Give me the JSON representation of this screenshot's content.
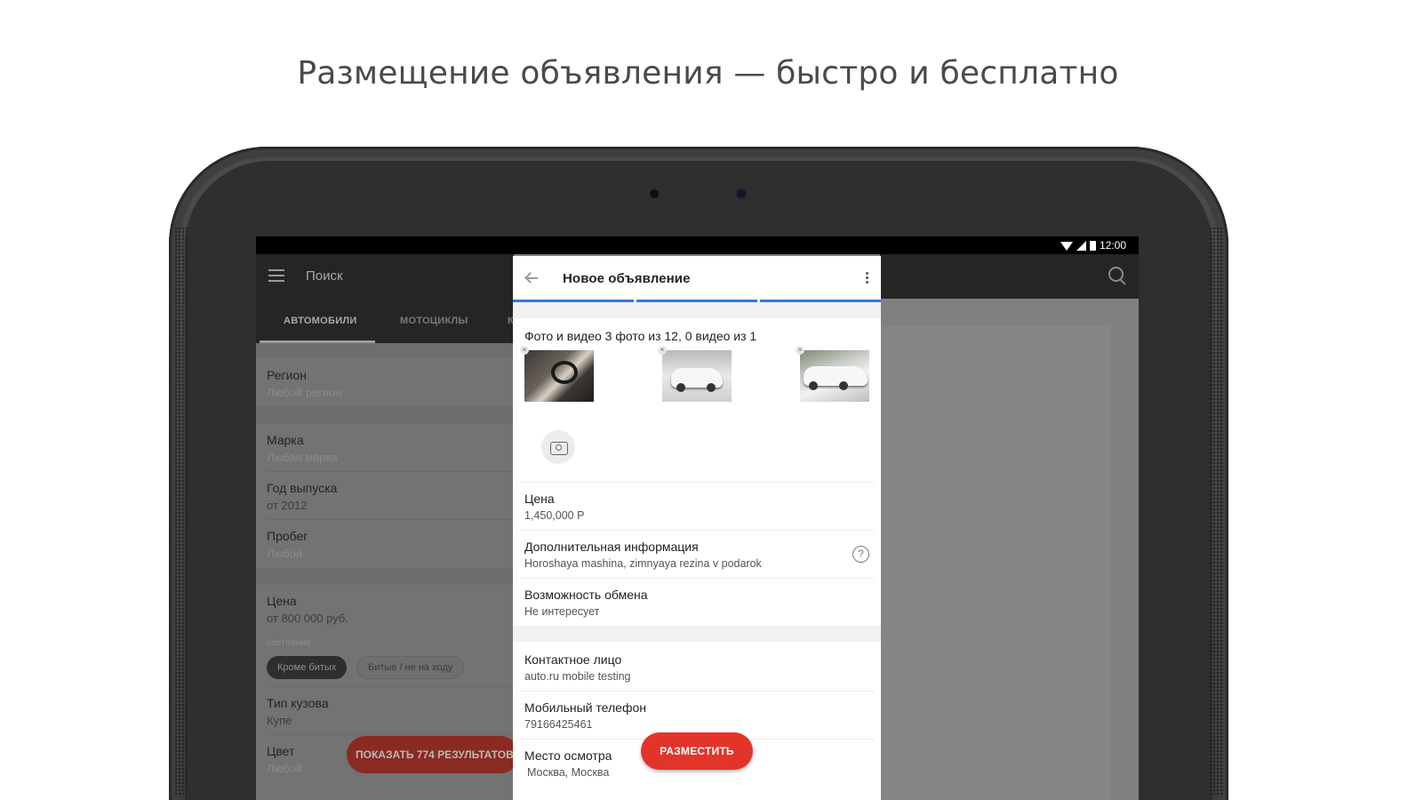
{
  "headline": "Размещение объявления — быстро и бесплатно",
  "statusbar": {
    "time": "12:00"
  },
  "search_screen": {
    "title": "Поиск",
    "tabs": [
      "АВТОМОБИЛИ",
      "МОТОЦИКЛЫ",
      "К"
    ],
    "filters": [
      {
        "label": "Регион",
        "value": "Любой регион"
      },
      {
        "label": "Марка",
        "value": "Любая марка"
      },
      {
        "label": "Год выпуска",
        "value": "от 2012"
      },
      {
        "label": "Пробег",
        "value": "Любой"
      },
      {
        "label": "Цена",
        "value": "от 800 000 руб."
      },
      {
        "label": "Тип кузова",
        "value": "Купе"
      },
      {
        "label": "Цвет",
        "value": "Любой"
      }
    ],
    "condition_caption": "состояние",
    "chips": [
      "Кроме битых",
      "Битые / не на ходу"
    ],
    "show_button": "ПОКАЗАТЬ 774 РЕЗУЛЬТАТОВ"
  },
  "dialog": {
    "title": "Новое объявление",
    "photos_title": "Фото и видео 3 фото из 12, 0 видео из 1",
    "remove_glyph": "×",
    "fields": [
      {
        "label": "Цена",
        "value": "1,450,000 Р"
      },
      {
        "label": "Дополнительная информация",
        "value": "Horoshaya mashina, zimnyaya rezina v podarok"
      },
      {
        "label": "Возможность обмена",
        "value": "Не интересует"
      },
      {
        "label": "Контактное лицо",
        "value": "auto.ru mobile testing"
      },
      {
        "label": "Мобильный телефон",
        "value": "79166425461"
      },
      {
        "label": "Место осмотра",
        "value": "Москва, Москва"
      }
    ],
    "help_glyph": "?",
    "post_button": "РАЗМЕСТИТЬ"
  },
  "colors": {
    "accent_red": "#e3342a",
    "progress_blue": "#2f7be0"
  }
}
